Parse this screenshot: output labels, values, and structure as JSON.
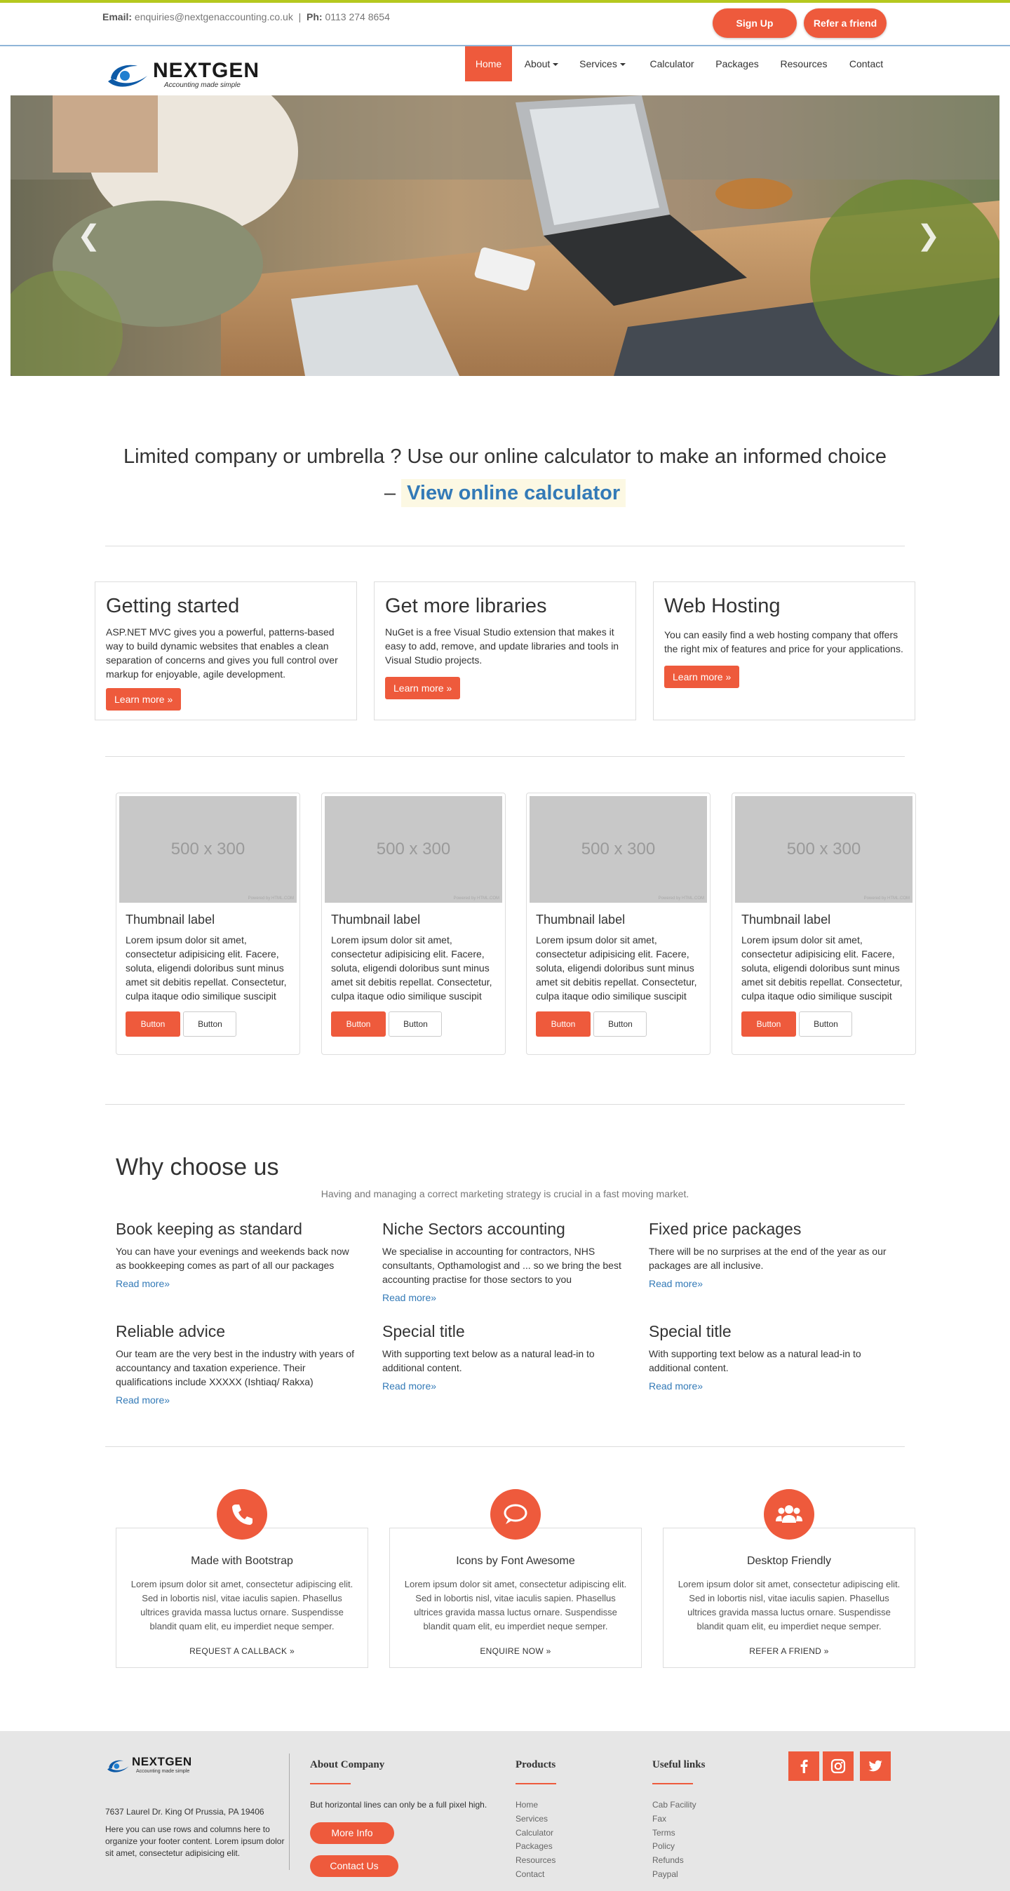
{
  "topbar": {
    "email_label": "Email:",
    "email": "enquiries@nextgenaccounting.co.uk",
    "separator": "|",
    "phone_label": "Ph:",
    "phone": "0113 274 8654",
    "signup": "Sign Up",
    "refer": "Refer a friend"
  },
  "brand": {
    "name": "NEXTGEN",
    "tagline": "Accounting made simple"
  },
  "nav": {
    "home": "Home",
    "about": "About",
    "services": "Services",
    "calculator": "Calculator",
    "packages": "Packages",
    "resources": "Resources",
    "contact": "Contact"
  },
  "hero": {
    "prev_icon": "chevron-left-icon",
    "next_icon": "chevron-right-icon"
  },
  "cta": {
    "text": "Limited company or umbrella ? Use our online calculator to make an informed choice",
    "dash": "–",
    "link": "View online calculator"
  },
  "features": [
    {
      "title": "Getting started",
      "text": "ASP.NET MVC gives you a powerful, patterns-based way to build dynamic websites that enables a clean separation of concerns and gives you full control over markup for enjoyable, agile development.",
      "button": "Learn more »"
    },
    {
      "title": "Get more libraries",
      "text": "NuGet is a free Visual Studio extension that makes it easy to add, remove, and update libraries and tools in Visual Studio projects.",
      "button": "Learn more »"
    },
    {
      "title": "Web Hosting",
      "text": "You can easily find a web hosting company that offers the right mix of features and price for your applications.",
      "button": "Learn more »"
    }
  ],
  "thumbnails": [
    {
      "image": "500 x 300",
      "credit": "Powered by HTML.COM",
      "label": "Thumbnail label",
      "text": "Lorem ipsum dolor sit amet, consectetur adipisicing elit. Facere, soluta, eligendi doloribus sunt minus amet sit debitis repellat. Consectetur, culpa itaque odio similique suscipit",
      "primary": "Button",
      "secondary": "Button"
    },
    {
      "image": "500 x 300",
      "credit": "Powered by HTML.COM",
      "label": "Thumbnail label",
      "text": "Lorem ipsum dolor sit amet, consectetur adipisicing elit. Facere, soluta, eligendi doloribus sunt minus amet sit debitis repellat. Consectetur, culpa itaque odio similique suscipit",
      "primary": "Button",
      "secondary": "Button"
    },
    {
      "image": "500 x 300",
      "credit": "Powered by HTML.COM",
      "label": "Thumbnail label",
      "text": "Lorem ipsum dolor sit amet, consectetur adipisicing elit. Facere, soluta, eligendi doloribus sunt minus amet sit debitis repellat. Consectetur, culpa itaque odio similique suscipit",
      "primary": "Button",
      "secondary": "Button"
    },
    {
      "image": "500 x 300",
      "credit": "Powered by HTML.COM",
      "label": "Thumbnail label",
      "text": "Lorem ipsum dolor sit amet, consectetur adipisicing elit. Facere, soluta, eligendi doloribus sunt minus amet sit debitis repellat. Consectetur, culpa itaque odio similique suscipit",
      "primary": "Button",
      "secondary": "Button"
    }
  ],
  "why": {
    "title": "Why choose us",
    "subtitle": "Having and managing a correct marketing strategy is crucial in a fast moving market.",
    "items": [
      {
        "title": "Book keeping as standard",
        "text": "You can have your evenings and weekends back now as bookkeeping comes as part of all our packages",
        "link": "Read more»"
      },
      {
        "title": "Niche Sectors accounting",
        "text": "We specialise in accounting for contractors, NHS consultants, Opthamologist and ... so we bring the best accounting practise for those sectors to you",
        "link": "Read more»"
      },
      {
        "title": "Fixed price packages",
        "text": "There will be no surprises at the end of the year as our packages are all inclusive.",
        "link": "Read more»"
      },
      {
        "title": "Reliable advice",
        "text": "Our team are the very best in the industry with years of accountancy and taxation experience. Their qualifications include XXXXX (Ishtiaq/ Rakxa)",
        "link": "Read more»"
      },
      {
        "title": "Special title",
        "text": "With supporting text below as a natural lead-in to additional content.",
        "link": "Read more»"
      },
      {
        "title": "Special title",
        "text": "With supporting text below as a natural lead-in to additional content.",
        "link": "Read more»"
      }
    ]
  },
  "info_cards": [
    {
      "icon": "phone-icon",
      "title": "Made with Bootstrap",
      "text": "Lorem ipsum dolor sit amet, consectetur adipiscing elit. Sed in lobortis nisl, vitae iaculis sapien. Phasellus ultrices gravida massa luctus ornare. Suspendisse blandit quam elit, eu imperdiet neque semper.",
      "link": "REQUEST A CALLBACK »"
    },
    {
      "icon": "speech-bubble-icon",
      "title": "Icons by Font Awesome",
      "text": "Lorem ipsum dolor sit amet, consectetur adipiscing elit. Sed in lobortis nisl, vitae iaculis sapien. Phasellus ultrices gravida massa luctus ornare. Suspendisse blandit quam elit, eu imperdiet neque semper.",
      "link": "ENQUIRE NOW »"
    },
    {
      "icon": "users-icon",
      "title": "Desktop Friendly",
      "text": "Lorem ipsum dolor sit amet, consectetur adipiscing elit. Sed in lobortis nisl, vitae iaculis sapien. Phasellus ultrices gravida massa luctus ornare. Suspendisse blandit quam elit, eu imperdiet neque semper.",
      "link": "REFER A FRIEND »"
    }
  ],
  "footer": {
    "address": "7637 Laurel Dr. King Of Prussia, PA 19406",
    "blurb": "Here you can use rows and columns here to organize your footer content. Lorem ipsum dolor sit amet, consectetur adipisicing elit.",
    "about_title": "About Company",
    "about_text": "But horizontal lines can only be a full pixel high.",
    "more_info": "More Info",
    "contact_us": "Contact Us",
    "products_title": "Products",
    "products": [
      "Home",
      "Services",
      "Calculator",
      "Packages",
      "Resources",
      "Contact"
    ],
    "links_title": "Useful links",
    "links": [
      "Cab Facility",
      "Fax",
      "Terms",
      "Policy",
      "Refunds",
      "Paypal"
    ],
    "social": [
      "facebook-icon",
      "instagram-icon",
      "twitter-icon"
    ]
  },
  "colors": {
    "accent": "#ee5a3c",
    "link": "#337ab7",
    "topline": "#b5c81f",
    "footer_bg": "#e6e6e6"
  }
}
